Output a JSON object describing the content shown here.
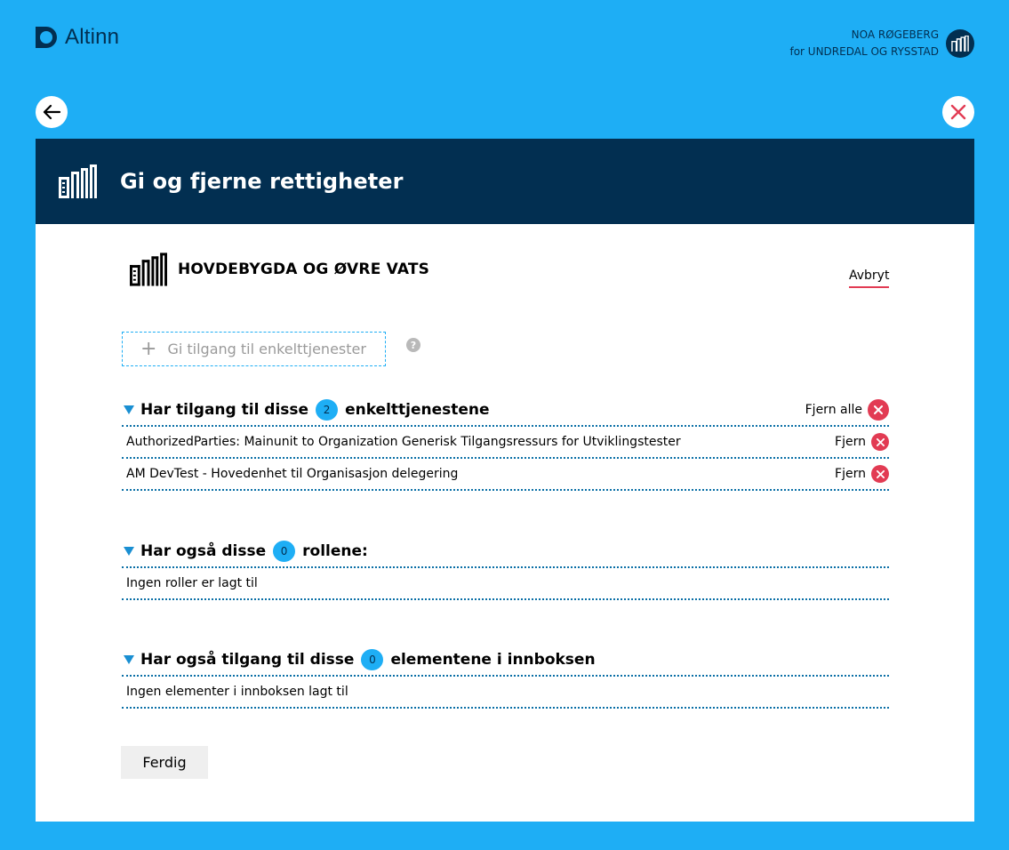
{
  "app": {
    "logo_text": "Altinn"
  },
  "user": {
    "name": "NOA RØGEBERG",
    "org_line": "for UNDREDAL OG RYSSTAD"
  },
  "header": {
    "title": "Gi og fjerne rettigheter"
  },
  "org": {
    "name": "HOVDEBYGDA OG ØVRE VATS",
    "cancel_label": "Avbryt"
  },
  "add": {
    "label": "Gi tilgang til enkelttjenester",
    "help": "?"
  },
  "services": {
    "title_pre": "Har tilgang til disse",
    "count": "2",
    "title_post": "enkelttjenestene",
    "remove_all": "Fjern alle",
    "items": [
      {
        "label": "AuthorizedParties: Mainunit to Organization Generisk Tilgangsressurs for Utviklingstester",
        "remove": "Fjern"
      },
      {
        "label": "AM DevTest - Hovedenhet til Organisasjon delegering",
        "remove": "Fjern"
      }
    ]
  },
  "roles": {
    "title_pre": "Har også disse",
    "count": "0",
    "title_post": "rollene:",
    "empty": "Ingen roller er lagt til"
  },
  "inbox": {
    "title_pre": "Har også tilgang til disse",
    "count": "0",
    "title_post": "elementene i innboksen",
    "empty": "Ingen elementer i innboksen lagt til"
  },
  "footer": {
    "done_label": "Ferdig"
  },
  "colors": {
    "background": "#1eaef5",
    "navy": "#022f51",
    "danger": "#e23b53"
  }
}
